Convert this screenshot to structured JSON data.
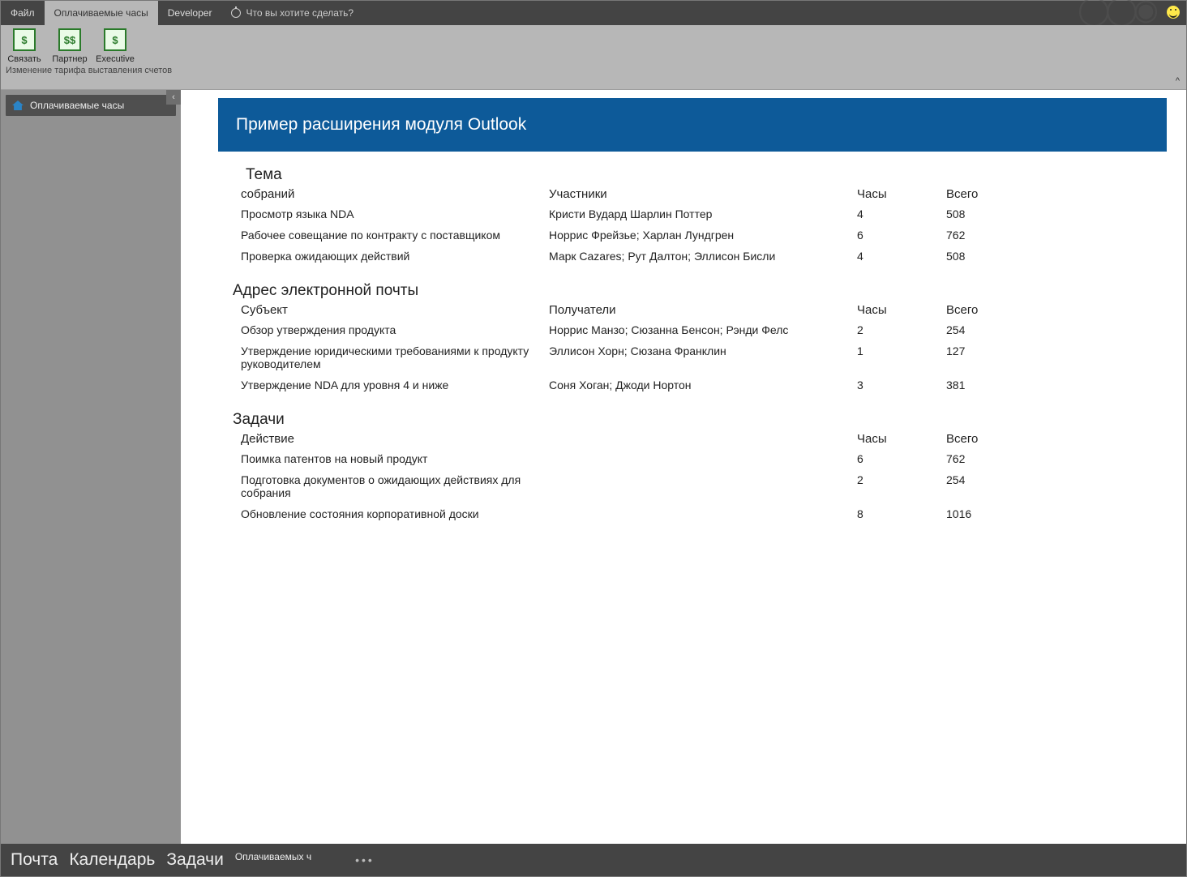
{
  "titlebar": {
    "tabs": [
      {
        "label": "Файл",
        "active": false
      },
      {
        "label": "Оплачиваемые часы",
        "active": true
      },
      {
        "label": "Developer",
        "active": false
      }
    ],
    "tellme": "Что вы хотите сделать?"
  },
  "ribbon": {
    "buttons": [
      {
        "glyph": "$",
        "label": "Связать"
      },
      {
        "glyph": "$$",
        "label": "Партнер"
      },
      {
        "glyph": "$",
        "label": "Executive"
      }
    ],
    "group_label": "Изменение тарифа выставления счетов"
  },
  "sidebar": {
    "items": [
      {
        "label": "Оплачиваемые часы"
      }
    ]
  },
  "banner": {
    "title": "Пример расширения модуля Outlook"
  },
  "sections": {
    "meetings": {
      "title_line1": "Тема",
      "title_line2": "собраний",
      "head": {
        "c2": "Участники",
        "c3": "Часы",
        "c4": "Всего"
      },
      "rows": [
        {
          "subject": "Просмотр языка NDA",
          "people": "Кристи Вудард Шарлин Поттер",
          "hours": "4",
          "total": "508"
        },
        {
          "subject": "Рабочее совещание по контракту с поставщиком",
          "people": "Норрис Фрейзье; Харлан Лундгрен",
          "hours": "6",
          "total": "762"
        },
        {
          "subject": "Проверка ожидающих действий",
          "people": "Марк Cazares; Рут Далтон; Эллисон Бисли",
          "hours": "4",
          "total": "508"
        }
      ]
    },
    "email": {
      "title": "Адрес электронной почты",
      "head": {
        "c1": "Субъект",
        "c2": "Получатели",
        "c3": "Часы",
        "c4": "Всего"
      },
      "rows": [
        {
          "subject": "Обзор утверждения продукта",
          "people": "Норрис Манзо; Сюзанна Бенсон; Рэнди Фелс",
          "hours": "2",
          "total": "254"
        },
        {
          "subject": "Утверждение юридическими требованиями к продукту руководителем",
          "people": "Эллисон Хорн; Сюзана Франклин",
          "hours": "1",
          "total": "127"
        },
        {
          "subject": "Утверждение NDA для уровня 4 и ниже",
          "people": "Соня Хоган; Джоди Нортон",
          "hours": "3",
          "total": "381"
        }
      ]
    },
    "tasks": {
      "title": "Задачи",
      "head": {
        "c1": "Действие",
        "c3": "Часы",
        "c4": "Всего"
      },
      "rows": [
        {
          "subject": "Поимка патентов на новый продукт",
          "hours": "6",
          "total": "762"
        },
        {
          "subject": "Подготовка документов о ожидающих действиях для собрания",
          "hours": "2",
          "total": "254"
        },
        {
          "subject": "Обновление состояния корпоративной доски",
          "hours": "8",
          "total": "1016"
        }
      ]
    }
  },
  "navbar": {
    "items": [
      {
        "label": "Почта"
      },
      {
        "label": "Календарь"
      },
      {
        "label": "Задачи"
      }
    ],
    "small": "Оплачиваемых ч"
  }
}
